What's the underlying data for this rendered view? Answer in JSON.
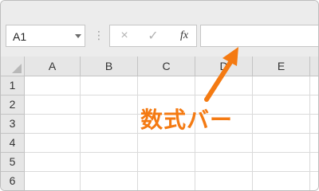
{
  "name_box": {
    "value": "A1"
  },
  "formula_bar": {
    "cancel_icon": "×",
    "enter_icon": "✓",
    "fx_label": "fx",
    "separator": "⋮",
    "value": ""
  },
  "columns": [
    "A",
    "B",
    "C",
    "D",
    "E"
  ],
  "rows": [
    "1",
    "2",
    "3",
    "4",
    "5",
    "6"
  ],
  "annotation": {
    "label": "数式バー",
    "color": "#f47a12",
    "target": "formula-input"
  }
}
